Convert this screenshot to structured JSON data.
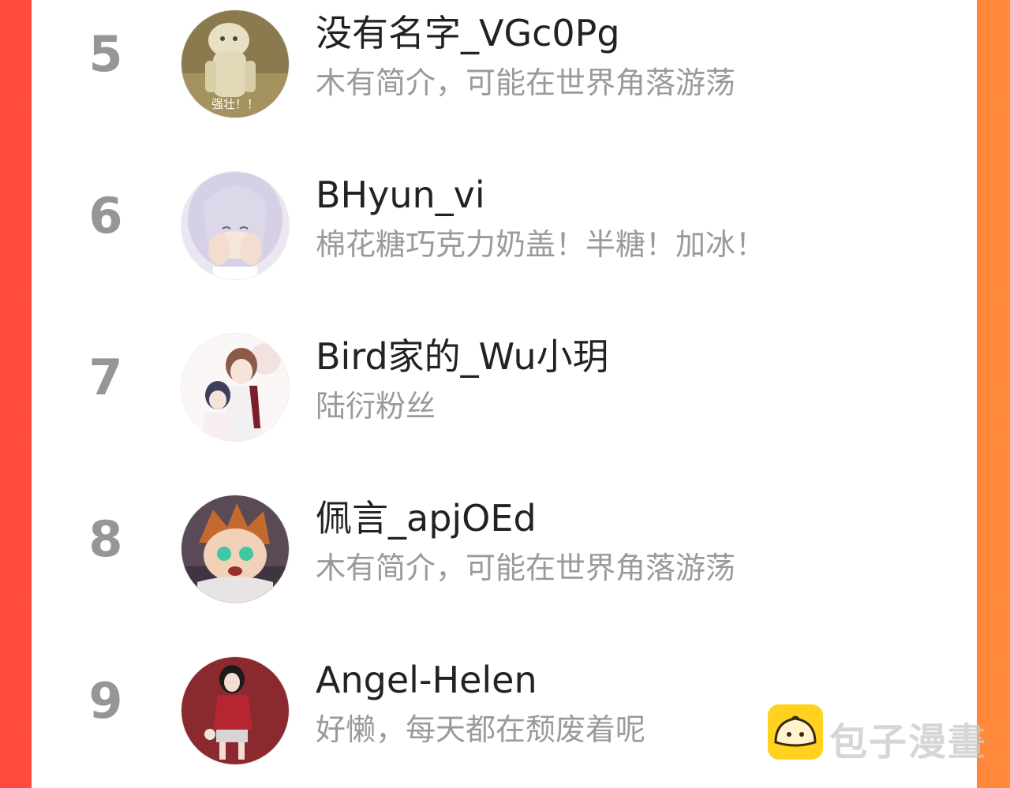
{
  "ranking": [
    {
      "rank": "5",
      "name": "没有名字_VGc0Pg",
      "bio": "木有简介，可能在世界角落游荡",
      "avatar_caption": "强壮！！"
    },
    {
      "rank": "6",
      "name": "BHyun_vi",
      "bio": "棉花糖巧克力奶盖！半糖！加冰！"
    },
    {
      "rank": "7",
      "name": "Bird家的_Wu小玥",
      "bio": "陆衍粉丝"
    },
    {
      "rank": "8",
      "name": "佩言_apjOEd",
      "bio": "木有简介，可能在世界角落游荡"
    },
    {
      "rank": "9",
      "name": "Angel-Helen",
      "bio": "好懒，每天都在颓废着呢"
    }
  ],
  "watermark": {
    "text": "包子漫畫",
    "icon": "bun-logo-icon"
  },
  "colors": {
    "accent_left": "#ff4a3d",
    "accent_right": "#ff8a3a",
    "rank": "#969696",
    "bio": "#9a9a9a"
  }
}
